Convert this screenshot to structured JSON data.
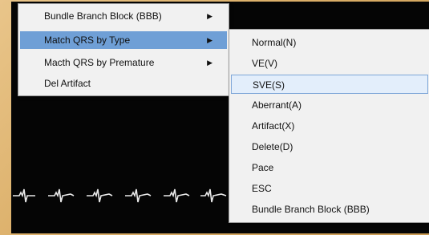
{
  "context_menu": {
    "items": [
      {
        "label": "Bundle Branch Block (BBB)",
        "has_submenu": true
      },
      {
        "label": "Match QRS by Type",
        "has_submenu": true
      },
      {
        "label": "Macth QRS by Premature",
        "has_submenu": true
      },
      {
        "label": "Del Artifact",
        "has_submenu": false
      }
    ],
    "arrow_glyph": "▶"
  },
  "submenu": {
    "items": [
      {
        "label": "Normal(N)"
      },
      {
        "label": "VE(V)"
      },
      {
        "label": "SVE(S)"
      },
      {
        "label": "Aberrant(A)"
      },
      {
        "label": "Artifact(X)"
      },
      {
        "label": "Delete(D)"
      },
      {
        "label": "Pace"
      },
      {
        "label": "ESC"
      },
      {
        "label": "Bundle Branch Block (BBB)"
      }
    ]
  },
  "colors": {
    "ecg_background": "#050505",
    "trace": "#e8e8e8",
    "selected": "#6f9fd6",
    "highlight": "#d6e6f7"
  }
}
